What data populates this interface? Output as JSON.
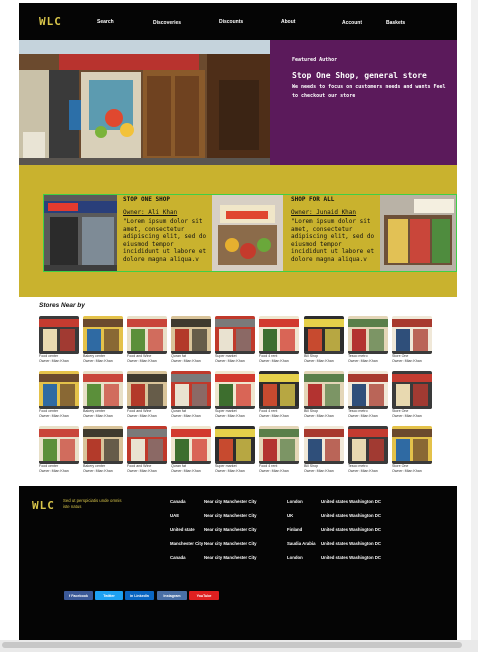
{
  "header": {
    "logo": "WLC",
    "nav": [
      "Search",
      "Discoveries",
      "Discounts",
      "About",
      "Account",
      "Baskets"
    ]
  },
  "hero": {
    "kicker": "Featured Author",
    "title": "Stop One Shop, general store",
    "text": "We needs to focus on customers needs and wants Feel to checkout our store"
  },
  "featured": [
    {
      "title": "STOP ONE SHOP",
      "owner": "Owner: Ali Khan",
      "body": "\"Lorem ipsum dolor sit amet, consectetur adipiscing elit, sed do eiusmod tempor incididunt ut labore et dolore magna aliqua.v"
    },
    {
      "title": "SHOP FOR ALL",
      "owner": "Owner: Junaid Khan",
      "body": "\"Lorem ipsum dolor sit amet, consectetur adipiscing elit, sed do eiusmod tempor incididunt ut labore et dolore magna aliqua.v"
    }
  ],
  "near": {
    "heading": "Stores Near by",
    "stores": [
      {
        "name": "Food center",
        "owner": "Owner: Mian Khan"
      },
      {
        "name": "Bakery center",
        "owner": "Owner: Mian Khan"
      },
      {
        "name": "Food and Wine",
        "owner": "Owner: Mian Khan"
      },
      {
        "name": "Quran fat",
        "owner": "Owner: Mian Khan"
      },
      {
        "name": "Super market",
        "owner": "Owner: Mian Khan"
      },
      {
        "name": "Food 4 rent",
        "owner": "Owner: Mian Khan"
      },
      {
        "name": "Bill Shop",
        "owner": "Owner: Mian Khan"
      },
      {
        "name": "Tesco metro",
        "owner": "Owner: Mian Khan"
      },
      {
        "name": "Store One",
        "owner": "Owner: Mian Khan"
      }
    ]
  },
  "footer": {
    "logo": "WLC",
    "tagline": "Sed ut perspiciatis unde omnis iste natus",
    "rows": [
      [
        "Canada",
        "Near city Manchester City",
        "London",
        "United states Washington DC"
      ],
      [
        "UAE",
        "Near city Manchester City",
        "UK",
        "United states Washington DC"
      ],
      [
        "United state",
        "Near city Manchester City",
        "Finland",
        "United states Washington DC"
      ],
      [
        "Manchester City",
        "Near city Manchester City",
        "Saudia Arabia",
        "United states Washington DC"
      ],
      [
        "Canada",
        "Near city Manchester City",
        "London",
        "United states Washington DC"
      ]
    ],
    "social": [
      "f Facebook",
      "Twitter",
      "in LinkedIn",
      "Instagram",
      "YouTube"
    ]
  },
  "colors": {
    "nav_bg": "#050505",
    "accent_gold": "#d8c54a",
    "hero_purple": "#5b1a5b",
    "band_yellow": "#c9b22e",
    "strip_border": "#3fd045",
    "facebook": "#3b5998",
    "twitter": "#1da1f2",
    "linkedin": "#0a66c2",
    "instagram": "#4a6fa5",
    "youtube": "#e02020"
  }
}
